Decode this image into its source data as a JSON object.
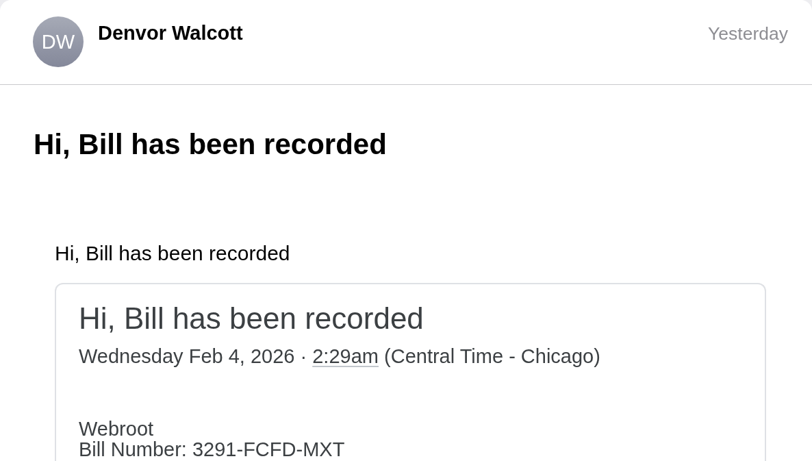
{
  "message": {
    "sender": {
      "initials": "DW",
      "name": "Denvor Walcott"
    },
    "time": "Yesterday",
    "subject": "Hi, Bill has been recorded",
    "body": {
      "intro": "Hi, Bill has been recorded",
      "card": {
        "title": "Hi, Bill has been recorded",
        "date": "Wednesday Feb 4, 2026 ·",
        "time_link": "2:29am",
        "timezone": "(Central Time - Chicago)",
        "lines": [
          "Webroot",
          "Bill Number: 3291-FCFD-MXT"
        ]
      }
    }
  }
}
